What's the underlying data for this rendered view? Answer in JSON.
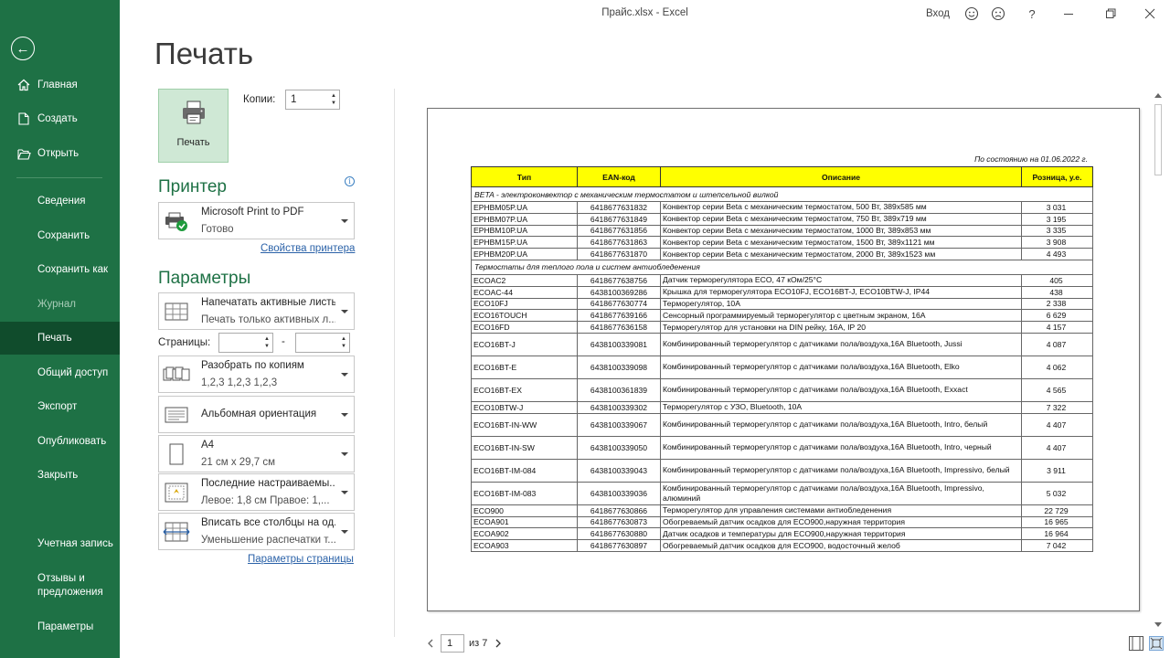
{
  "titlebar": {
    "doc_title": "Прайс.xlsx  -  Excel",
    "signin": "Вход",
    "help": "?",
    "icons": [
      "smiley-icon",
      "frown-icon",
      "minimize-icon",
      "restore-icon",
      "close-icon"
    ]
  },
  "nav": {
    "back": "←",
    "home": "Главная",
    "new": "Создать",
    "open": "Открыть",
    "info": "Сведения",
    "save": "Сохранить",
    "save_as": "Сохранить как",
    "history": "Журнал",
    "print": "Печать",
    "share": "Общий доступ",
    "export": "Экспорт",
    "publish": "Опубликовать",
    "close": "Закрыть",
    "account": "Учетная запись",
    "feedback_1": "Отзывы и",
    "feedback_2": "предложения",
    "options": "Параметры"
  },
  "page_title": "Печать",
  "print_panel": {
    "print_button": "Печать",
    "copies_label": "Копии:",
    "copies_value": "1",
    "printer_heading": "Принтер",
    "printer_name": "Microsoft Print to PDF",
    "printer_status": "Готово",
    "printer_props_link": "Свойства принтера",
    "settings_heading": "Параметры",
    "what_line1": "Напечатать активные листы",
    "what_line2": "Печать только активных л...",
    "pages_label": "Страницы:",
    "pages_dash": "-",
    "collate_line1": "Разобрать по копиям",
    "collate_line2": "1,2,3    1,2,3    1,2,3",
    "orientation_line1": "Альбомная ориентация",
    "paper_line1": "A4",
    "paper_line2": "21 см x 29,7 см",
    "margins_line1": "Последние настраиваемы...",
    "margins_line2": "Левое:  1,8 см    Правое:  1,...",
    "scaling_line1": "Вписать все столбцы на од...",
    "scaling_line2": "Уменьшение распечатки т...",
    "page_setup_link": "Параметры страницы"
  },
  "preview": {
    "status_line": "По состоянию на 01.06.2022 г.",
    "headers": [
      "Тип",
      "EAN-код",
      "Описание",
      "Розница, у.е."
    ],
    "groups": [
      {
        "title": "BETA - электроконвектор с механическим термостатом и штепсельной вилкой",
        "rows": [
          {
            "type": "EPHBM05P.UA",
            "ean": "6418677631832",
            "desc": "Конвектор серии Beta с механическим термостатом, 500 Вт, 389х585 мм",
            "price": "3 031",
            "tall": false
          },
          {
            "type": "EPHBM07P.UA",
            "ean": "6418677631849",
            "desc": "Конвектор серии Beta с механическим термостатом, 750 Вт, 389х719 мм",
            "price": "3 195",
            "tall": false
          },
          {
            "type": "EPHBM10P.UA",
            "ean": "6418677631856",
            "desc": "Конвектор серии Beta с механическим термостатом, 1000 Вт, 389х853 мм",
            "price": "3 335",
            "tall": false
          },
          {
            "type": "EPHBM15P.UA",
            "ean": "6418677631863",
            "desc": "Конвектор серии Beta с механическим термостатом, 1500 Вт, 389х1121 мм",
            "price": "3 908",
            "tall": false
          },
          {
            "type": "EPHBM20P.UA",
            "ean": "6418677631870",
            "desc": "Конвектор серии Beta с механическим термостатом, 2000 Вт, 389х1523 мм",
            "price": "4 493",
            "tall": false
          }
        ]
      },
      {
        "title": "Термостаты для теплого пола и систем антиобледенения",
        "rows": [
          {
            "type": "ECOAC2",
            "ean": "6418677638756",
            "desc": "Датчик терморегулятора ECO, 47 кОм/25°C",
            "price": "405",
            "tall": false
          },
          {
            "type": "ECOAC-44",
            "ean": "6438100369286",
            "desc": "Крышка для терморегулятора ECO10FJ, ECO16BT-J, ECO10BTW-J,  IP44",
            "price": "438",
            "tall": false
          },
          {
            "type": "ECO10FJ",
            "ean": "6418677630774",
            "desc": "Терморегулятор, 10А",
            "price": "2 338",
            "tall": false
          },
          {
            "type": "ECO16TOUCH",
            "ean": "6418677639166",
            "desc": "Сенсорный программируемый терморегулятор с цветным экраном, 16А",
            "price": "6 629",
            "tall": false
          },
          {
            "type": "ECO16FD",
            "ean": "6418677636158",
            "desc": "Терморегулятор для установки на DIN рейку, 16А, IP 20",
            "price": "4 157",
            "tall": false
          },
          {
            "type": "ECO16BT-J",
            "ean": "6438100339081",
            "desc": "Комбинированный терморегулятор с датчиками пола/воздуха,16А Bluetooth, Jussi",
            "price": "4 087",
            "tall": true
          },
          {
            "type": "ECO16BT-E",
            "ean": "6438100339098",
            "desc": "Комбинированный терморегулятор с датчиками пола/воздуха,16А Bluetooth, Elko",
            "price": "4 062",
            "tall": true
          },
          {
            "type": "ECO16BT-EX",
            "ean": "6438100361839",
            "desc": "Комбинированный терморегулятор с датчиками пола/воздуха,16А Bluetooth, Exxact",
            "price": "4 565",
            "tall": true
          },
          {
            "type": "ECO10BTW-J",
            "ean": "6438100339302",
            "desc": "Терморегулятор с УЗО, Bluetooth, 10А",
            "price": "7 322",
            "tall": false
          },
          {
            "type": "ECO16BT-IN-WW",
            "ean": "6438100339067",
            "desc": "Комбинированный терморегулятор с датчиками пола/воздуха,16А Bluetooth, Intro, белый",
            "price": "4 407",
            "tall": true
          },
          {
            "type": "ECO16BT-IN-SW",
            "ean": "6438100339050",
            "desc": "Комбинированный терморегулятор с датчиками пола/воздуха,16А Bluetooth, Intro, черный",
            "price": "4 407",
            "tall": true
          },
          {
            "type": "ECO16BT-IM-084",
            "ean": "6438100339043",
            "desc": "Комбинированный терморегулятор с датчиками пола/воздуха,16А Bluetooth, Impressivo, белый",
            "price": "3 911",
            "tall": true
          },
          {
            "type": "ECO16BT-IM-083",
            "ean": "6438100339036",
            "desc": "Комбинированный терморегулятор с датчиками пола/воздуха,16А Bluetooth, Impressivo, алюминий",
            "price": "5 032",
            "tall": true
          },
          {
            "type": "ECO900",
            "ean": "6418677630866",
            "desc": "Терморегулятор для управления системами антиобледенения",
            "price": "22 729",
            "tall": false
          },
          {
            "type": "ECOA901",
            "ean": "6418677630873",
            "desc": "Обогреваемый датчик осадков для ECO900,наружная территория",
            "price": "16 965",
            "tall": false
          },
          {
            "type": "ECOA902",
            "ean": "6418677630880",
            "desc": "Датчик осадков и температуры для ECO900,наружная территория",
            "price": "16 964",
            "tall": false
          },
          {
            "type": "ECOA903",
            "ean": "6418677630897",
            "desc": "Обогреваемый датчик осадков для ECO900, водосточный желоб",
            "price": "7 042",
            "tall": false
          }
        ]
      }
    ]
  },
  "pager": {
    "current_page": "1",
    "of_label": "из 7"
  },
  "colors": {
    "rail": "#1e7145",
    "rail_active": "#104c2c",
    "accent": "#1e7145",
    "header_fill": "#ffff00",
    "link": "#2b62a8"
  }
}
